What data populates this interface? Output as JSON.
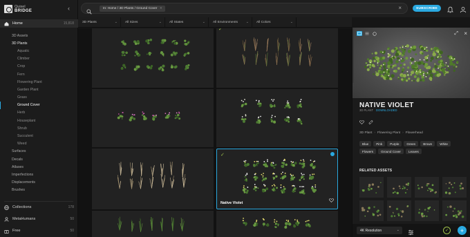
{
  "app": {
    "logo_line1": "Quixel",
    "logo_line2": "BRIDGE"
  },
  "sidebar": {
    "home": {
      "label": "Home",
      "count": "15,818"
    },
    "tree": [
      {
        "label": "3D Assets",
        "level": 0
      },
      {
        "label": "3D Plants",
        "level": 0,
        "selected": true
      },
      {
        "label": "Aquatic",
        "level": 1
      },
      {
        "label": "Climber",
        "level": 1
      },
      {
        "label": "Crop",
        "level": 1
      },
      {
        "label": "Fern",
        "level": 1
      },
      {
        "label": "Flowering Plant",
        "level": 1
      },
      {
        "label": "Garden Plant",
        "level": 1
      },
      {
        "label": "Grass",
        "level": 1
      },
      {
        "label": "Ground Cover",
        "level": 1,
        "active": true
      },
      {
        "label": "Herb",
        "level": 1
      },
      {
        "label": "Houseplant",
        "level": 1
      },
      {
        "label": "Shrub",
        "level": 1
      },
      {
        "label": "Succulent",
        "level": 1
      },
      {
        "label": "Weed",
        "level": 1
      },
      {
        "label": "Surfaces",
        "level": 0
      },
      {
        "label": "Decals",
        "level": 0
      },
      {
        "label": "Atlases",
        "level": 0
      },
      {
        "label": "Imperfections",
        "level": 0
      },
      {
        "label": "Displacements",
        "level": 0
      },
      {
        "label": "Brushes",
        "level": 0
      }
    ],
    "bottom": [
      {
        "label": "Collections",
        "count": "178",
        "icon": "globe-icon"
      },
      {
        "label": "MetaHumans",
        "count": "50",
        "icon": "person-icon"
      },
      {
        "label": "Free",
        "count": "50",
        "icon": "gift-icon"
      }
    ]
  },
  "topbar": {
    "search_chip": "In: Home / 3D Plants / Ground Cover",
    "subscribe_label": "SUBSCRIBE"
  },
  "filters": [
    {
      "label": "3D Plants"
    },
    {
      "label": "All Sizes"
    },
    {
      "label": "All States"
    },
    {
      "label": "All Environments"
    },
    {
      "label": "All Colors"
    }
  ],
  "grid": {
    "selected_label": "Native Violet"
  },
  "detail": {
    "title": "NATIVE VIOLET",
    "type": "3D PLANT",
    "status": "DOWNLOADED",
    "breadcrumb": [
      "3D Plant",
      "Flowering Plant",
      "Flowerhead"
    ],
    "tags": [
      "Blue",
      "Pink",
      "Purple",
      "Green",
      "Brown",
      "White",
      "Flowers",
      "Ground Cover",
      "Leaves"
    ],
    "related_title": "RELATED ASSETS",
    "resolution": "4K Resolution"
  },
  "colors": {
    "accent": "#2aa9e0",
    "downloaded_check": "#9fc24a"
  }
}
